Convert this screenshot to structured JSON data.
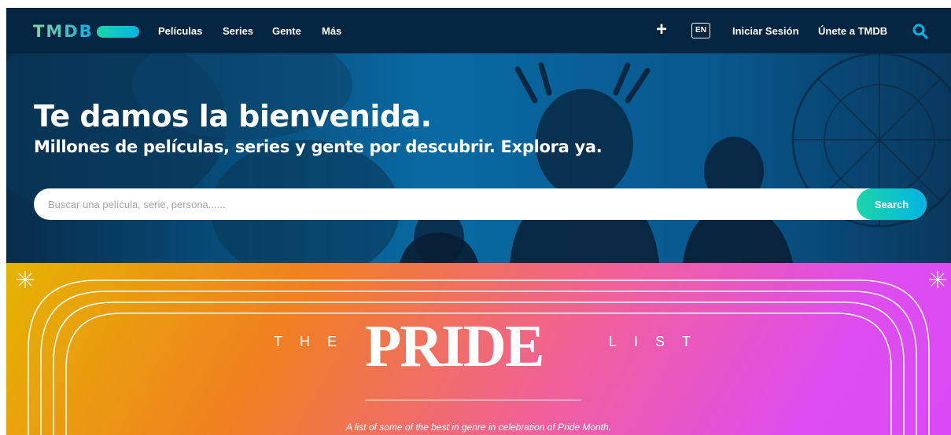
{
  "nav": {
    "logo_text": "TMDB",
    "links": [
      "Películas",
      "Series",
      "Gente",
      "Más"
    ],
    "add_icon": "plus-icon",
    "language": "EN",
    "login": "Iniciar Sesión",
    "join": "Únete a TMDB",
    "search_icon": "search-icon"
  },
  "hero": {
    "title": "Te damos la bienvenida.",
    "subtitle": "Millones de películas, series y gente por descubrir. Explora ya.",
    "search_placeholder": "Buscar una película, serie, persona......",
    "search_button": "Search"
  },
  "banner": {
    "word_left": "THE",
    "word_center": "PRIDE",
    "word_right": "LIST",
    "description": "A list of some of the best in genre in celebration of Pride Month."
  },
  "colors": {
    "nav_bg": "#032541",
    "accent_green": "#1ed5a9",
    "accent_blue": "#01b4e4"
  }
}
